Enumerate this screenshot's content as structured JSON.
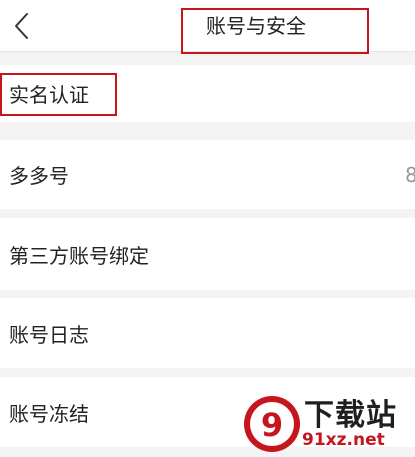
{
  "header": {
    "title": "账号与安全",
    "back_icon": "chevron-left-icon"
  },
  "rows": [
    {
      "label": "实名认证",
      "value": ""
    },
    {
      "label": "多多号",
      "value": "8"
    },
    {
      "label": "第三方账号绑定",
      "value": ""
    },
    {
      "label": "账号日志",
      "value": ""
    },
    {
      "label": "账号冻结",
      "value": ""
    }
  ],
  "watermark": {
    "logo_mark": "9",
    "logo_text": "下载站",
    "site": "91xz.net"
  },
  "colors": {
    "background": "#f3f3f3",
    "row_background": "#ffffff",
    "annotation_red": "#c4161c",
    "text": "#222222",
    "value_text": "#999999"
  }
}
